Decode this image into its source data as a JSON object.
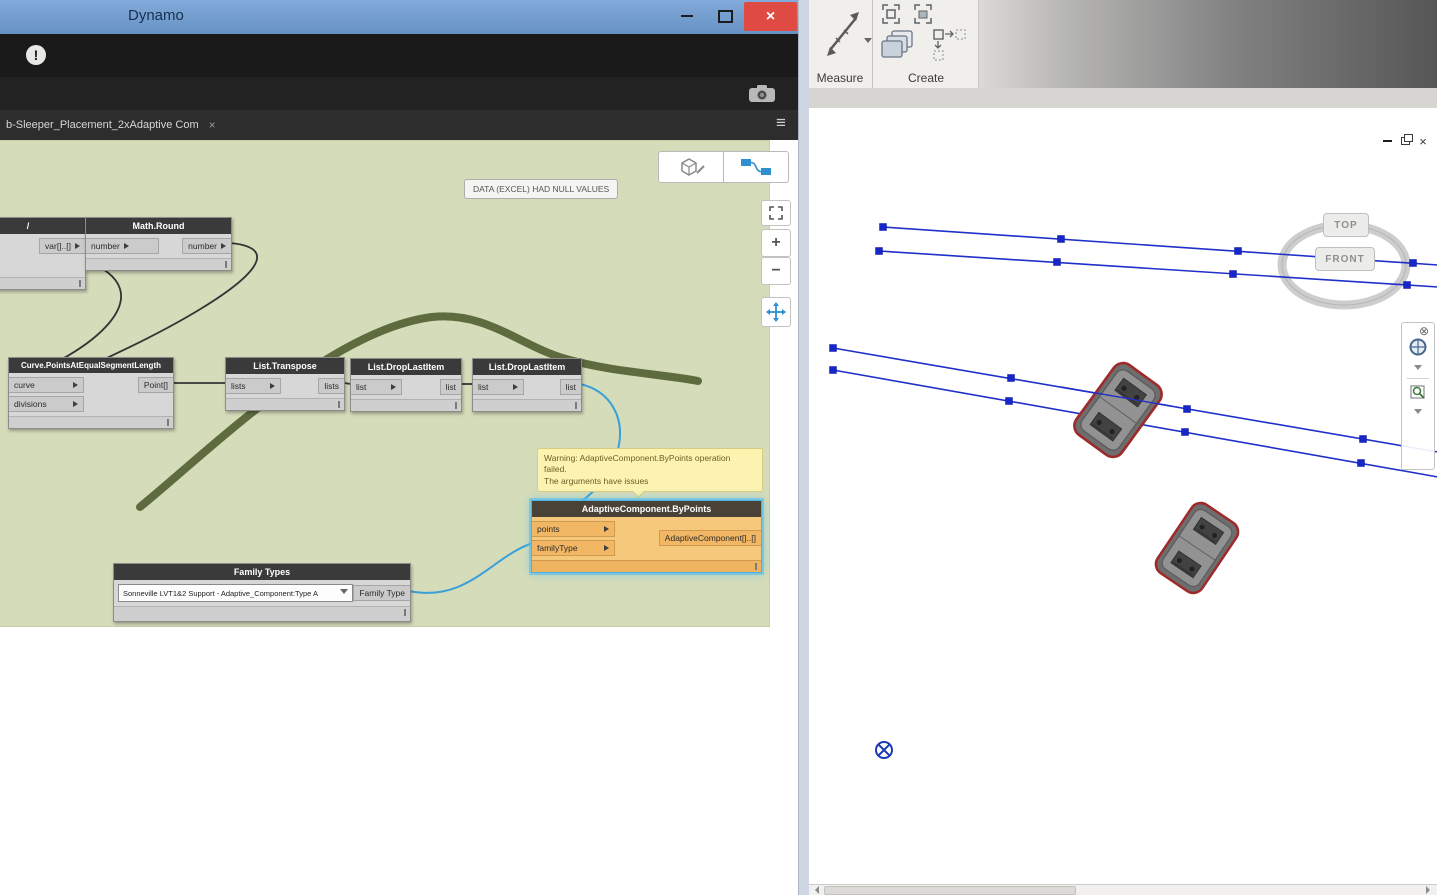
{
  "icons": {
    "menu": "≡",
    "close": "×",
    "tab_close": "×",
    "alert": "!",
    "plus": "+",
    "minus": "−"
  },
  "colors": {
    "titlebar_blue": "#6f9bd1",
    "close_red": "#df4a42",
    "group_green": "#d5dcba",
    "node_header_gray": "#3a3a3a",
    "selection_blue": "#38a6e0",
    "selected_node_orange": "#f6c87c",
    "wire_blue": "#3aa0d8",
    "geometry_curve_olive": "#5e6b3f",
    "revit_line_blue": "#1b2fd0",
    "warning_yellow": "#fcf3b0"
  },
  "dynamo": {
    "title": "Dynamo",
    "tab": "b-Sleeper_Placement_2xAdaptive Com",
    "null_value_tooltip": "DATA (EXCEL) HAD NULL VALUES",
    "warning": {
      "line1": "Warning: AdaptiveComponent.ByPoints operation",
      "line2": "failed.",
      "line3": "The arguments have issues"
    },
    "nodes": {
      "divide": {
        "title": "/",
        "output": "var[]..[]"
      },
      "math_round": {
        "title": "Math.Round",
        "input": "number",
        "output": "number"
      },
      "curve_points": {
        "title": "Curve.PointsAtEqualSegmentLength",
        "inputs": [
          "curve",
          "divisions"
        ],
        "output": "Point[]"
      },
      "list_transpose": {
        "title": "List.Transpose",
        "input": "lists",
        "output": "lists"
      },
      "drop_last_1": {
        "title": "List.DropLastItem",
        "input": "list",
        "output": "list"
      },
      "drop_last_2": {
        "title": "List.DropLastItem",
        "input": "list",
        "output": "list"
      },
      "adaptive": {
        "title": "AdaptiveComponent.ByPoints",
        "inputs": [
          "points",
          "familyType"
        ],
        "output": "AdaptiveComponent[]..[]"
      },
      "family_types": {
        "title": "Family Types",
        "selected": "Sonneville LVT1&2 Support - Adaptive_Component:Type A",
        "output": "Family Type"
      }
    }
  },
  "revit": {
    "panels": {
      "measure": "Measure",
      "create": "Create"
    },
    "viewcube": {
      "top": "TOP",
      "front": "FRONT"
    }
  }
}
